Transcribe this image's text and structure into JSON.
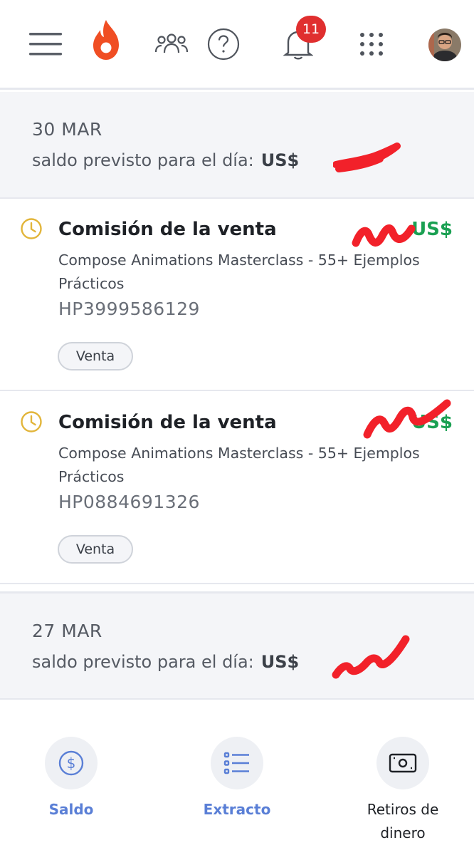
{
  "topbar": {
    "notification_count": "11",
    "icons": [
      "menu-icon",
      "hotmart-flame-logo",
      "people-icon",
      "help-icon",
      "bell-icon",
      "apps-grid-icon",
      "user-avatar"
    ]
  },
  "days": [
    {
      "date": "30 MAR",
      "balance_label": "saldo previsto para el día:",
      "balance_amount": "US$"
    },
    {
      "date": "27 MAR",
      "balance_label": "saldo previsto para el día:",
      "balance_amount": "US$"
    }
  ],
  "transactions": [
    {
      "title": "Comisión de la venta",
      "amount": "US$",
      "product": "Compose Animations Masterclass - 55+ Ejemplos Prácticos",
      "code": "HP3999586129",
      "tag": "Venta"
    },
    {
      "title": "Comisión de la venta",
      "amount": "US$",
      "product": "Compose Animations Masterclass - 55+ Ejemplos Prácticos",
      "code": "HP0884691326",
      "tag": "Venta"
    }
  ],
  "bottom_nav": {
    "saldo": "Saldo",
    "extracto": "Extracto",
    "retiros": "Retiros de dinero"
  },
  "colors": {
    "accent_blue": "#5a7fd6",
    "amount_green": "#1aa052",
    "badge_red": "#e02f2f",
    "logo_orange": "#f04e23",
    "pending_clock": "#e2b53a",
    "redaction_red": "#f2212a"
  }
}
